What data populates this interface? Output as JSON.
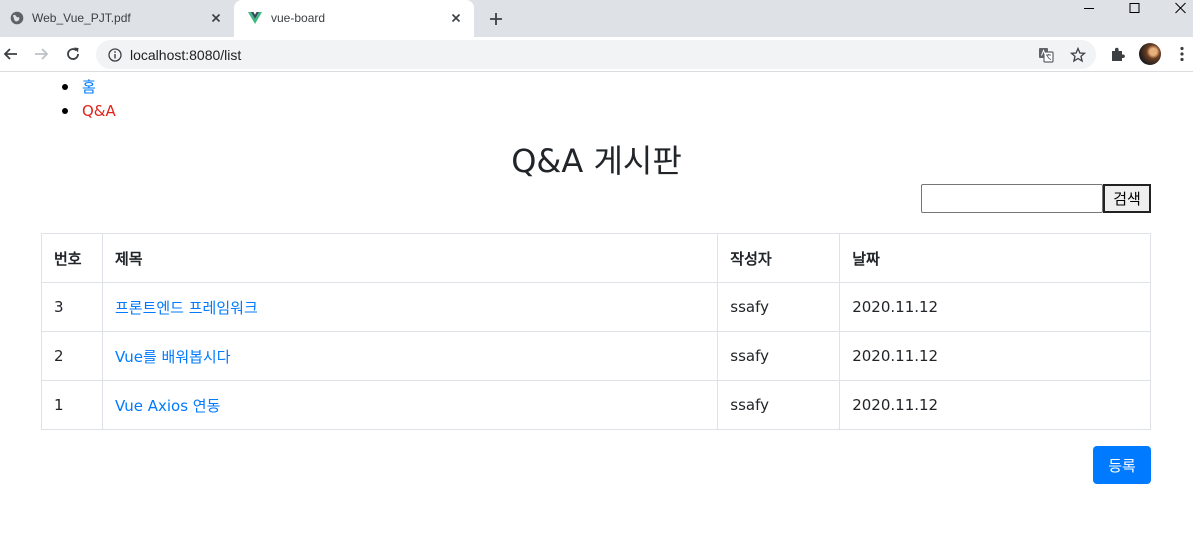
{
  "browser": {
    "tabs": [
      {
        "title": "Web_Vue_PJT.pdf",
        "active": false,
        "icon": "globe-icon"
      },
      {
        "title": "vue-board",
        "active": true,
        "icon": "vue-logo-icon"
      }
    ],
    "url": "localhost:8080/list"
  },
  "nav": {
    "items": [
      {
        "label": "홈",
        "color": "#007bff"
      },
      {
        "label": "Q&A",
        "color": "#e2231a"
      }
    ]
  },
  "board": {
    "title": "Q&A 게시판",
    "search": {
      "value": "",
      "button_label": "검색"
    },
    "columns": [
      "번호",
      "제목",
      "작성자",
      "날짜"
    ],
    "rows": [
      {
        "no": "3",
        "title": "프론트엔드 프레임워크",
        "writer": "ssafy",
        "date": "2020.11.12"
      },
      {
        "no": "2",
        "title": "Vue를 배워봅시다",
        "writer": "ssafy",
        "date": "2020.11.12"
      },
      {
        "no": "1",
        "title": "Vue Axios 연동",
        "writer": "ssafy",
        "date": "2020.11.12"
      }
    ],
    "register_label": "등록"
  },
  "colors": {
    "link": "#007bff",
    "active_nav": "#e2231a",
    "primary_button": "#007bff"
  }
}
